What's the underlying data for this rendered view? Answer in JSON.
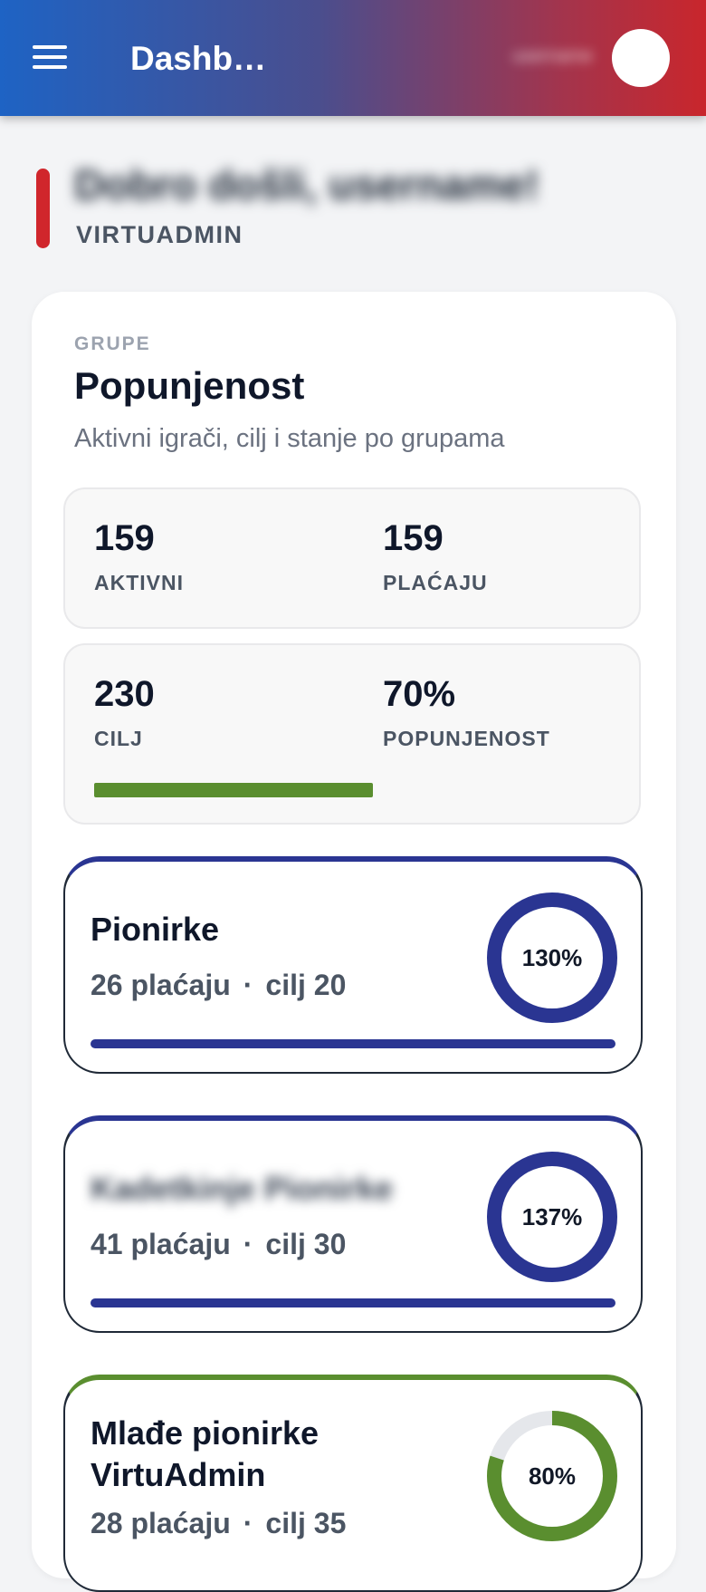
{
  "header": {
    "title": "Dashbo…",
    "user_name": "username",
    "colors": {
      "gradient_start": "#1e63c4",
      "gradient_end": "#c9262c"
    }
  },
  "welcome": {
    "greeting": "Dobro došli, username!",
    "role": "VIRTUADMIN"
  },
  "card": {
    "eyebrow": "GRUPE",
    "title": "Popunjenost",
    "subtitle": "Aktivni igrači, cilj i stanje po grupama",
    "stats": {
      "active_value": "159",
      "active_label": "AKTIVNI",
      "paying_value": "159",
      "paying_label": "PLAĆAJU",
      "goal_value": "230",
      "goal_label": "CILJ",
      "fill_value": "70%",
      "fill_label": "POPUNJENOST",
      "fill_fraction": 0.7
    },
    "groups": [
      {
        "name": "Pionirke",
        "paying": "26 plaćaju",
        "goal": "cilj 20",
        "percent": "130%",
        "fraction": 1.0,
        "color": "#2a3592",
        "name_blurred": false
      },
      {
        "name": "Kadetkinje Pionirke",
        "paying": "41 plaćaju",
        "goal": "cilj 30",
        "percent": "137%",
        "fraction": 1.0,
        "color": "#2a3592",
        "name_blurred": true
      },
      {
        "name_line1": "Mlađe pionirke",
        "name_line2": "VirtuAdmin",
        "paying": "28 plaćaju",
        "goal": "cilj 35",
        "percent": "80%",
        "fraction": 0.8,
        "color": "#5a8e2f",
        "name_blurred": false
      }
    ],
    "separator": "·"
  }
}
